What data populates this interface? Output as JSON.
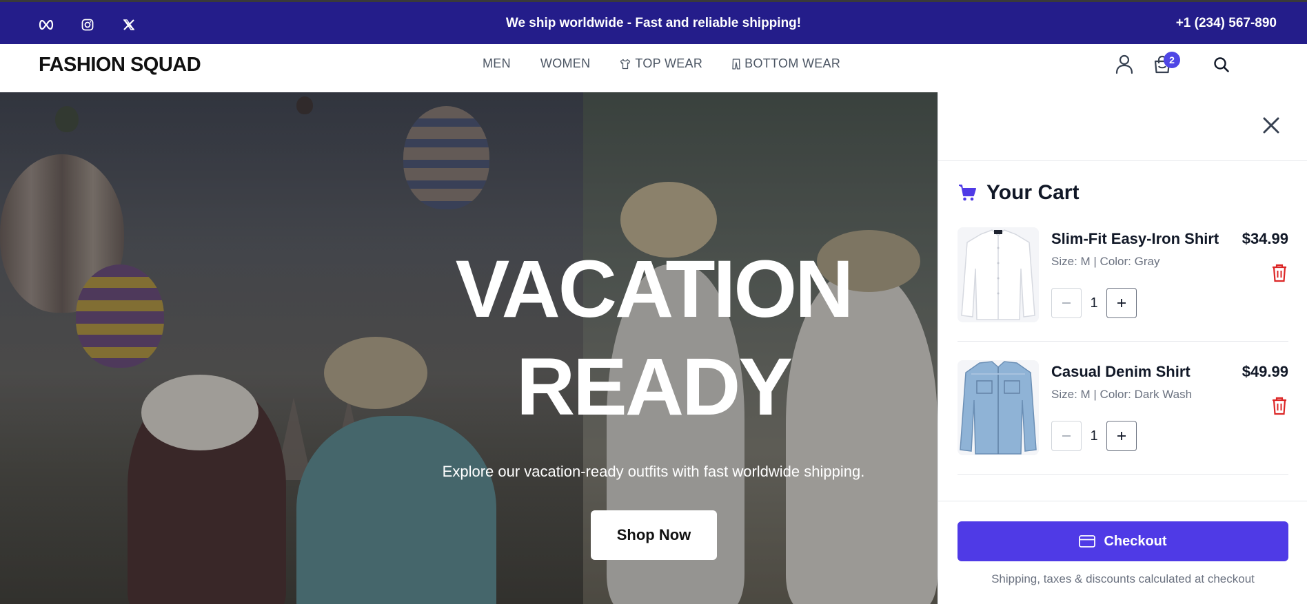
{
  "topbar": {
    "social_icons": [
      "meta-icon",
      "instagram-icon",
      "x-icon"
    ],
    "announcement": "We ship worldwide - Fast and reliable shipping!",
    "phone": "+1 (234) 567-890",
    "background": "#241d8a"
  },
  "navbar": {
    "logo": "FASHION SQUAD",
    "links": [
      {
        "label": "MEN",
        "icon": null
      },
      {
        "label": "WOMEN",
        "icon": null
      },
      {
        "label": "TOP WEAR",
        "icon": "shirt-icon"
      },
      {
        "label": "BOTTOM WEAR",
        "icon": "pants-icon"
      }
    ],
    "cart_count": "2",
    "icons": [
      "user-icon",
      "shopping-bag-icon",
      "search-icon"
    ]
  },
  "hero": {
    "title_line1": "VACATION",
    "title_line2": "READY",
    "subtitle": "Explore our vacation-ready outfits with fast worldwide shipping.",
    "cta": "Shop Now"
  },
  "cart": {
    "title": "Your Cart",
    "items": [
      {
        "name": "Slim-Fit Easy-Iron Shirt",
        "meta": "Size: M | Color: Gray",
        "price": "$34.99",
        "qty": "1"
      },
      {
        "name": "Casual Denim Shirt",
        "meta": "Size: M | Color: Dark Wash",
        "price": "$49.99",
        "qty": "1"
      }
    ],
    "checkout_label": "Checkout",
    "note": "Shipping, taxes & discounts calculated at checkout",
    "accent": "#4f3ae6",
    "delete_color": "#dc2626"
  }
}
